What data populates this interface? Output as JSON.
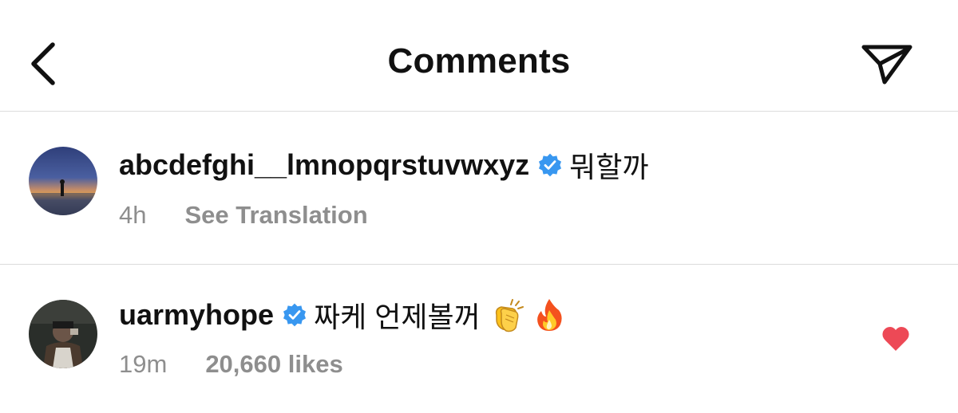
{
  "header": {
    "title": "Comments",
    "back_icon": "chevron-left-icon",
    "send_icon": "paper-plane-icon"
  },
  "comments": [
    {
      "username": "abcdefghi__lmnopqrstuvwxyz",
      "verified": true,
      "text": "뭐할까",
      "time": "4h",
      "action": "See Translation",
      "liked": false
    },
    {
      "username": "uarmyhope",
      "verified": true,
      "text": "짜케 언제볼꺼",
      "emojis": [
        "clapping-hands-emoji",
        "fire-emoji"
      ],
      "time": "19m",
      "action": "20,660 likes",
      "liked": true
    }
  ],
  "colors": {
    "verified": "#3897f0",
    "heart": "#ed4956",
    "secondary_text": "#8e8e8e",
    "divider": "#dcdcdc"
  }
}
